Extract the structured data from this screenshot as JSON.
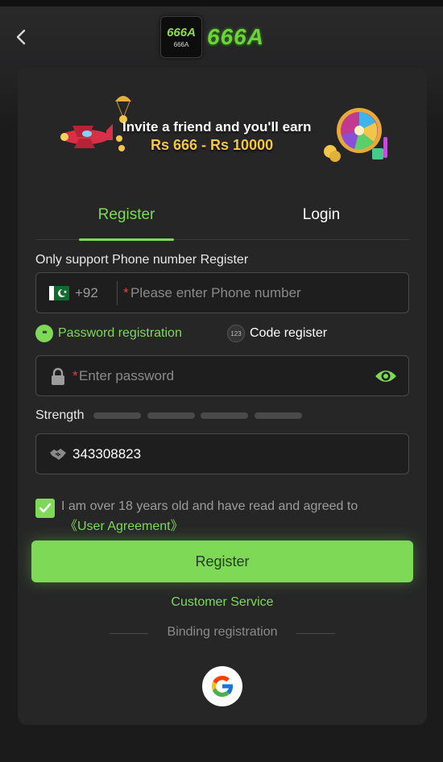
{
  "header": {
    "back_icon": "chevron-left-icon",
    "logo_box_text": "666A",
    "logo_box_small": "666A",
    "logo_text": "666A"
  },
  "banner": {
    "line1": "Invite a friend and you'll earn",
    "line2": "Rs 666 - Rs 10000"
  },
  "tabs": {
    "register": "Register",
    "login": "Login"
  },
  "form": {
    "note": "Only support Phone number Register",
    "phone": {
      "country_code": "+92",
      "required_mark": "*",
      "placeholder": "Please enter Phone number"
    },
    "options": {
      "password_registration": "Password registration",
      "code_register": "Code register",
      "code_icon_text": "123",
      "password_icon_text": "**"
    },
    "password": {
      "required_mark": "*",
      "placeholder": "Enter password"
    },
    "strength_label": "Strength",
    "referral_code": "343308823",
    "agreement": {
      "text": "I am over 18 years old and have read and agreed to",
      "link": "《User Agreement》",
      "checked": true
    },
    "register_button": "Register"
  },
  "footer": {
    "customer_service": "Customer Service",
    "binding_registration": "Binding registration"
  },
  "colors": {
    "accent": "#7ed957",
    "background": "#1b1b1c",
    "card": "#262627",
    "required": "#e0433a",
    "gold": "#f2c64b"
  }
}
